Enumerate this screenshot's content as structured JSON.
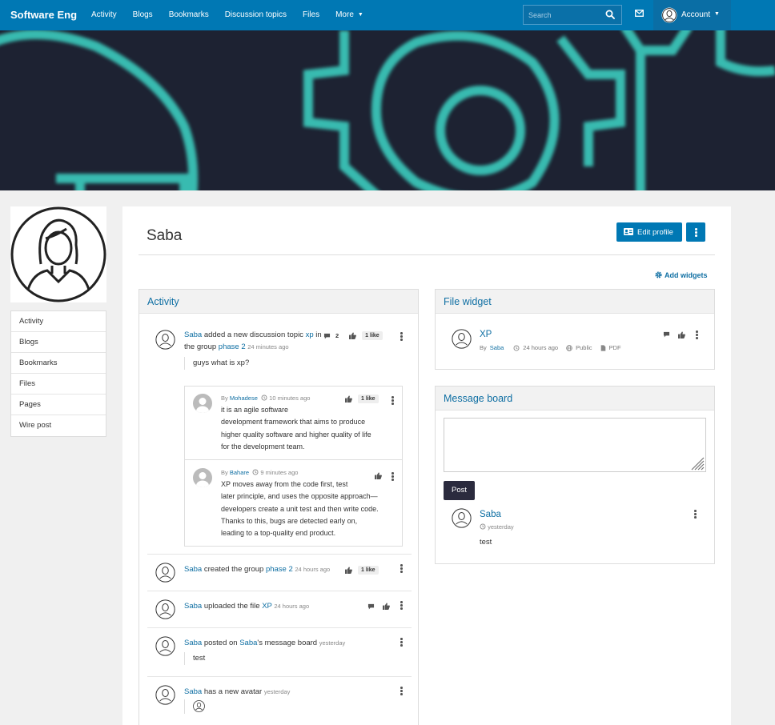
{
  "topbar": {
    "brand": "Software Eng",
    "nav": [
      "Activity",
      "Blogs",
      "Bookmarks",
      "Discussion topics",
      "Files",
      "More"
    ],
    "search_placeholder": "Search",
    "account_label": "Account"
  },
  "sidebar": {
    "items": [
      "Activity",
      "Blogs",
      "Bookmarks",
      "Files",
      "Pages",
      "Wire post"
    ]
  },
  "profile": {
    "name": "Saba",
    "edit_button": "Edit profile",
    "add_widgets": "Add widgets"
  },
  "activity": {
    "title": "Activity",
    "item1": {
      "user": "Saba",
      "action": " added a new discussion topic ",
      "target": "xp",
      "mid": " in the group ",
      "group": "phase 2",
      "time": "24 minutes ago",
      "comments_count": "2",
      "likes": "1 like",
      "excerpt": "guys what is xp?"
    },
    "comment1": {
      "by": "By",
      "user": "Mohadese",
      "time": "10 minutes ago",
      "likes": "1 like",
      "lines": [
        "it is an agile software",
        "development framework that aims to produce",
        "higher quality software and higher quality of life",
        "for the development team."
      ]
    },
    "comment2": {
      "by": "By",
      "user": "Bahare",
      "time": "9 minutes ago",
      "lines": [
        "XP moves away from the code first, test",
        "later principle, and uses the opposite approach—",
        "developers create a unit test and then write code.",
        "Thanks to this, bugs are detected early on,",
        "leading to a top-quality end product."
      ]
    },
    "item2": {
      "user": "Saba",
      "action": " created the group ",
      "target": "phase 2",
      "time": "24 hours ago",
      "likes": "1 like"
    },
    "item3": {
      "user": "Saba",
      "action": " uploaded the file ",
      "target": "XP",
      "time": "24 hours ago"
    },
    "item4": {
      "user": "Saba",
      "action": " posted on ",
      "target": "Saba",
      "action2": "'s message board",
      "time": "yesterday",
      "excerpt": "test"
    },
    "item5": {
      "user": "Saba",
      "action": " has a new avatar",
      "time": "yesterday"
    }
  },
  "file_widget": {
    "title": "File widget",
    "name": "XP",
    "by": "By",
    "user": "Saba",
    "time": "24 hours ago",
    "access": "Public",
    "type": "PDF"
  },
  "message_board": {
    "title": "Message board",
    "post_button": "Post",
    "message": {
      "user": "Saba",
      "time": "yesterday",
      "text": "test"
    }
  },
  "colors": {
    "brand": "#0078b4",
    "link": "#0f6fa3",
    "post_button": "#2b2b3e",
    "banner": "#1d2232",
    "banner_glow": "#3ed6c6"
  },
  "icons": [
    "search-icon",
    "mail-icon",
    "user-avatar-icon",
    "caret-down-icon",
    "id-card-icon",
    "kebab-icon",
    "gear-icon",
    "comment-icon",
    "thumbs-up-icon",
    "history-icon",
    "globe-icon",
    "file-icon",
    "resize-handle-icon"
  ]
}
